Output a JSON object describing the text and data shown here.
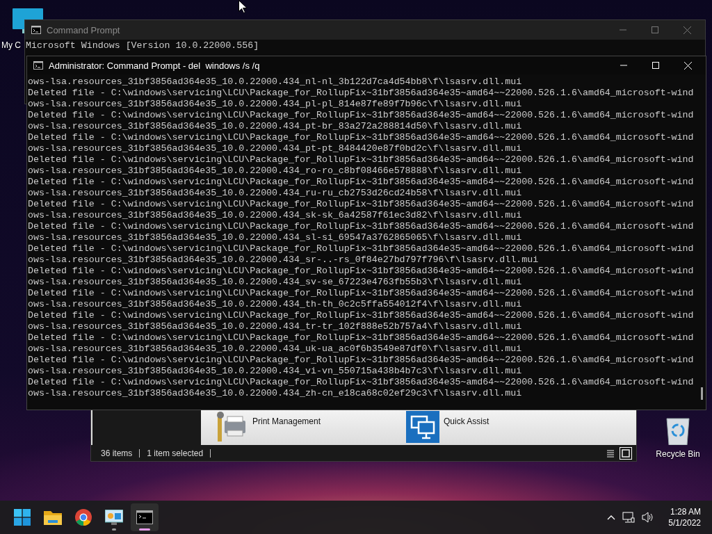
{
  "desktop": {
    "icons": [
      {
        "kind": "computer",
        "label": "My C"
      },
      {
        "kind": "recycle-bin",
        "label": "Recycle Bin"
      }
    ]
  },
  "background_window": {
    "title": "Command Prompt",
    "lines": [
      "Microsoft Windows [Version 10.0.22000.556]"
    ]
  },
  "explorer_window": {
    "items": [
      {
        "kind": "printer",
        "label": "Print Management"
      },
      {
        "kind": "remote",
        "label": "Quick Assist"
      }
    ],
    "status": [
      "36 items",
      "1 item selected"
    ],
    "view_buttons": [
      {
        "kind": "details",
        "selected": false
      },
      {
        "kind": "tiles",
        "selected": true
      }
    ]
  },
  "console_window": {
    "title": "Administrator: Command Prompt - del  windows /s /q",
    "lines": [
      "ows-lsa.resources_31bf3856ad364e35_10.0.22000.434_nl-nl_3b122d7ca4d54bb8\\f\\lsasrv.dll.mui",
      "Deleted file - C:\\windows\\servicing\\LCU\\Package_for_RollupFix~31bf3856ad364e35~amd64~~22000.526.1.6\\amd64_microsoft-wind",
      "ows-lsa.resources_31bf3856ad364e35_10.0.22000.434_pl-pl_814e87fe89f7b96c\\f\\lsasrv.dll.mui",
      "Deleted file - C:\\windows\\servicing\\LCU\\Package_for_RollupFix~31bf3856ad364e35~amd64~~22000.526.1.6\\amd64_microsoft-wind",
      "ows-lsa.resources_31bf3856ad364e35_10.0.22000.434_pt-br_83a272a288814d50\\f\\lsasrv.dll.mui",
      "Deleted file - C:\\windows\\servicing\\LCU\\Package_for_RollupFix~31bf3856ad364e35~amd64~~22000.526.1.6\\amd64_microsoft-wind",
      "ows-lsa.resources_31bf3856ad364e35_10.0.22000.434_pt-pt_8484420e87f0bd2c\\f\\lsasrv.dll.mui",
      "Deleted file - C:\\windows\\servicing\\LCU\\Package_for_RollupFix~31bf3856ad364e35~amd64~~22000.526.1.6\\amd64_microsoft-wind",
      "ows-lsa.resources_31bf3856ad364e35_10.0.22000.434_ro-ro_c8bf08466e578888\\f\\lsasrv.dll.mui",
      "Deleted file - C:\\windows\\servicing\\LCU\\Package_for_RollupFix~31bf3856ad364e35~amd64~~22000.526.1.6\\amd64_microsoft-wind",
      "ows-lsa.resources_31bf3856ad364e35_10.0.22000.434_ru-ru_cb2753d26cd24b58\\f\\lsasrv.dll.mui",
      "Deleted file - C:\\windows\\servicing\\LCU\\Package_for_RollupFix~31bf3856ad364e35~amd64~~22000.526.1.6\\amd64_microsoft-wind",
      "ows-lsa.resources_31bf3856ad364e35_10.0.22000.434_sk-sk_6a42587f61ec3d82\\f\\lsasrv.dll.mui",
      "Deleted file - C:\\windows\\servicing\\LCU\\Package_for_RollupFix~31bf3856ad364e35~amd64~~22000.526.1.6\\amd64_microsoft-wind",
      "ows-lsa.resources_31bf3856ad364e35_10.0.22000.434_sl-si_69547a3762865065\\f\\lsasrv.dll.mui",
      "Deleted file - C:\\windows\\servicing\\LCU\\Package_for_RollupFix~31bf3856ad364e35~amd64~~22000.526.1.6\\amd64_microsoft-wind",
      "ows-lsa.resources_31bf3856ad364e35_10.0.22000.434_sr-..-rs_0f84e27bd797f796\\f\\lsasrv.dll.mui",
      "Deleted file - C:\\windows\\servicing\\LCU\\Package_for_RollupFix~31bf3856ad364e35~amd64~~22000.526.1.6\\amd64_microsoft-wind",
      "ows-lsa.resources_31bf3856ad364e35_10.0.22000.434_sv-se_67223e4763fb55b3\\f\\lsasrv.dll.mui",
      "Deleted file - C:\\windows\\servicing\\LCU\\Package_for_RollupFix~31bf3856ad364e35~amd64~~22000.526.1.6\\amd64_microsoft-wind",
      "ows-lsa.resources_31bf3856ad364e35_10.0.22000.434_th-th_0c2c5ffa554012f4\\f\\lsasrv.dll.mui",
      "Deleted file - C:\\windows\\servicing\\LCU\\Package_for_RollupFix~31bf3856ad364e35~amd64~~22000.526.1.6\\amd64_microsoft-wind",
      "ows-lsa.resources_31bf3856ad364e35_10.0.22000.434_tr-tr_102f888e52b757a4\\f\\lsasrv.dll.mui",
      "Deleted file - C:\\windows\\servicing\\LCU\\Package_for_RollupFix~31bf3856ad364e35~amd64~~22000.526.1.6\\amd64_microsoft-wind",
      "ows-lsa.resources_31bf3856ad364e35_10.0.22000.434_uk-ua_ac0f6b3549e87df0\\f\\lsasrv.dll.mui",
      "Deleted file - C:\\windows\\servicing\\LCU\\Package_for_RollupFix~31bf3856ad364e35~amd64~~22000.526.1.6\\amd64_microsoft-wind",
      "ows-lsa.resources_31bf3856ad364e35_10.0.22000.434_vi-vn_550715a438b4b7c3\\f\\lsasrv.dll.mui",
      "Deleted file - C:\\windows\\servicing\\LCU\\Package_for_RollupFix~31bf3856ad364e35~amd64~~22000.526.1.6\\amd64_microsoft-wind",
      "ows-lsa.resources_31bf3856ad364e35_10.0.22000.434_zh-cn_e18ca68c02ef29c3\\f\\lsasrv.dll.mui"
    ]
  },
  "taskbar": {
    "apps": [
      {
        "kind": "start",
        "running": false,
        "selected": false
      },
      {
        "kind": "folder",
        "running": false,
        "selected": false
      },
      {
        "kind": "browser",
        "running": false,
        "selected": false
      },
      {
        "kind": "monitor",
        "running": true,
        "selected": false
      },
      {
        "kind": "terminal",
        "running": true,
        "selected": true
      }
    ],
    "time": "1:28 AM",
    "date": "5/1/2022"
  }
}
